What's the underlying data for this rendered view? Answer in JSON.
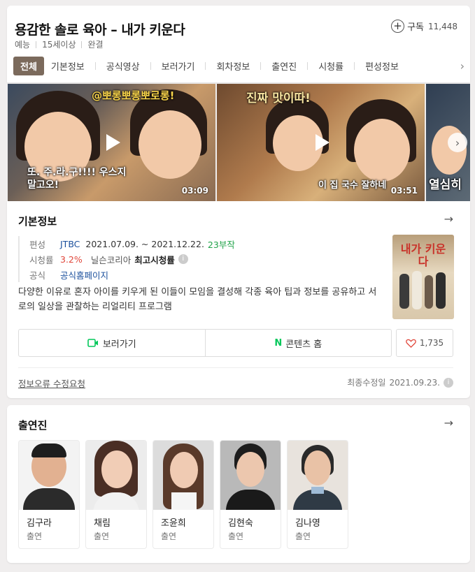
{
  "header": {
    "title": "용감한 솔로 육아 – 내가 키운다",
    "subscribe_label": "구독",
    "subscribe_count": "11,448",
    "meta": [
      "예능",
      "15세이상",
      "완결"
    ],
    "tabs": [
      "전체",
      "기본정보",
      "공식영상",
      "보러가기",
      "회차정보",
      "출연진",
      "시청률",
      "편성정보"
    ]
  },
  "clips": [
    {
      "overlay_top": "@뽀롱뽀롱뽀로롱!",
      "overlay_bottom": "또. 주.라.구!!!! 우스지 말고오!",
      "duration": "03:09"
    },
    {
      "overlay_top": "진짜 맛이따!",
      "overlay_bottom": "이 집 국수 잘하네",
      "duration": "03:51"
    },
    {
      "overlay_bottom": "열심히"
    }
  ],
  "info": {
    "section_title": "기본정보",
    "rows": {
      "schedule_label": "편성",
      "channel": "JTBC",
      "period": "2021.07.09. ~ 2021.12.22.",
      "episodes": "23부작",
      "rating_label": "시청률",
      "rating_value": "3.2%",
      "rating_source": "닐슨코리아",
      "rating_type": "최고시청률",
      "official_label": "공식",
      "official_link": "공식홈페이지"
    },
    "description": "다양한 이유로 혼자 아이를 키우게 된 이들이 모임을 결성해 각종 육아 팁과 정보를 공유하고 서로의 일상을 관찰하는 리얼리티 프로그램",
    "poster_text": "내가 키운다",
    "watch_button": "보러가기",
    "content_home_button": "콘텐츠 홈",
    "likes": "1,735",
    "report_link": "정보오류 수정요청",
    "updated_label": "최종수정일",
    "updated_date": "2021.09.23."
  },
  "cast": {
    "section_title": "출연진",
    "members": [
      {
        "name": "김구라",
        "role": "출연"
      },
      {
        "name": "채림",
        "role": "출연"
      },
      {
        "name": "조윤희",
        "role": "출연"
      },
      {
        "name": "김현숙",
        "role": "출연"
      },
      {
        "name": "김나영",
        "role": "출연"
      }
    ]
  },
  "colors": {
    "active_tab": "#7b6a5c",
    "link_blue": "#1a4f9c",
    "rating_red": "#e0463a",
    "episode_green": "#22a34a",
    "naver_green": "#03c75a"
  }
}
